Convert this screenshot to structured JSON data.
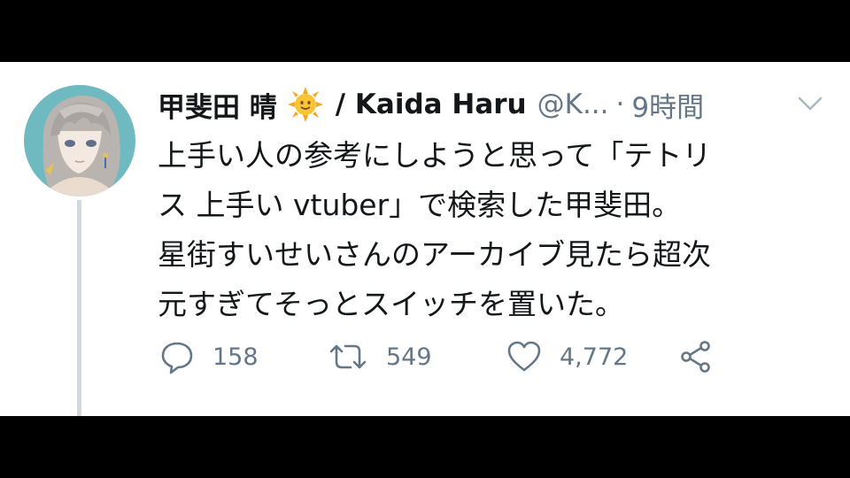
{
  "tweet": {
    "display_name": "甲斐田 晴",
    "display_name_latin": "/ Kaida Haru",
    "handle": "@K...",
    "separator": "·",
    "timestamp": "9時間",
    "name_emoji": "sun-with-face-icon",
    "body_lines": [
      "上手い人の参考にしようと思って「テトリ",
      "ス 上手い vtuber」で検索した甲斐田。",
      "星街すいせいさんのアーカイブ見たら超次",
      "元すぎてそっとスイッチを置いた。"
    ],
    "actions": {
      "reply_count": "158",
      "retweet_count": "549",
      "like_count": "4,772"
    }
  },
  "colors": {
    "background": "#000000",
    "card": "#ffffff",
    "text": "#14171a",
    "muted": "#657786",
    "thread_line": "#cfd9de",
    "avatar_bg": "#6fb9c0"
  }
}
